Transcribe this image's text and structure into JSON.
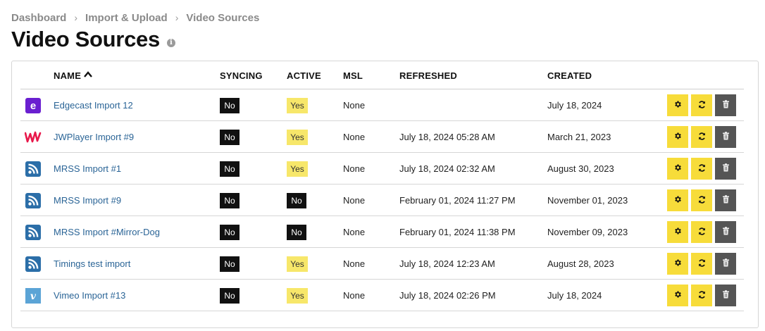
{
  "breadcrumb": {
    "items": [
      "Dashboard",
      "Import & Upload"
    ],
    "current": "Video Sources",
    "separator": "›"
  },
  "page": {
    "title": "Video Sources",
    "info_icon": "info-icon"
  },
  "table": {
    "headers": {
      "name": "NAME",
      "syncing": "SYNCING",
      "active": "ACTIVE",
      "msl": "MSL",
      "refreshed": "REFRESHED",
      "created": "CREATED"
    },
    "sort": {
      "column": "name",
      "direction": "ascending"
    },
    "rows": [
      {
        "logo": "edgecast-logo",
        "name": "Edgecast Import 12",
        "syncing": "No",
        "active": "Yes",
        "msl": "None",
        "refreshed": "",
        "created": "July 18, 2024"
      },
      {
        "logo": "jwplayer-logo",
        "name": "JWPlayer Import #9",
        "syncing": "No",
        "active": "Yes",
        "msl": "None",
        "refreshed": "July 18, 2024 05:28 AM",
        "created": "March 21, 2023"
      },
      {
        "logo": "rss-logo",
        "name": "MRSS Import #1",
        "syncing": "No",
        "active": "Yes",
        "msl": "None",
        "refreshed": "July 18, 2024 02:32 AM",
        "created": "August 30, 2023"
      },
      {
        "logo": "rss-logo",
        "name": "MRSS Import #9",
        "syncing": "No",
        "active": "No",
        "msl": "None",
        "refreshed": "February 01, 2024 11:27 PM",
        "created": "November 01, 2023"
      },
      {
        "logo": "rss-logo",
        "name": "MRSS Import #Mirror-Dog",
        "syncing": "No",
        "active": "No",
        "msl": "None",
        "refreshed": "February 01, 2024 11:38 PM",
        "created": "November 09, 2023"
      },
      {
        "logo": "rss-logo",
        "name": "Timings test import",
        "syncing": "No",
        "active": "Yes",
        "msl": "None",
        "refreshed": "July 18, 2024 12:23 AM",
        "created": "August 28, 2023"
      },
      {
        "logo": "vimeo-logo",
        "name": "Vimeo Import #13",
        "syncing": "No",
        "active": "Yes",
        "msl": "None",
        "refreshed": "July 18, 2024 02:26 PM",
        "created": "July 18, 2024"
      }
    ],
    "row_actions": [
      "gear-icon",
      "refresh-icon",
      "trash-icon"
    ]
  },
  "colors": {
    "link": "#2a6496",
    "yes_badge": "#f7e76a",
    "no_badge": "#111111",
    "action_button": "#f7dc3a",
    "delete_button": "#555555",
    "edgecast": "#6a1fd0",
    "jwplayer": "#e8194b",
    "rss": "#2b6ea8",
    "vimeo": "#5ba4d6"
  }
}
